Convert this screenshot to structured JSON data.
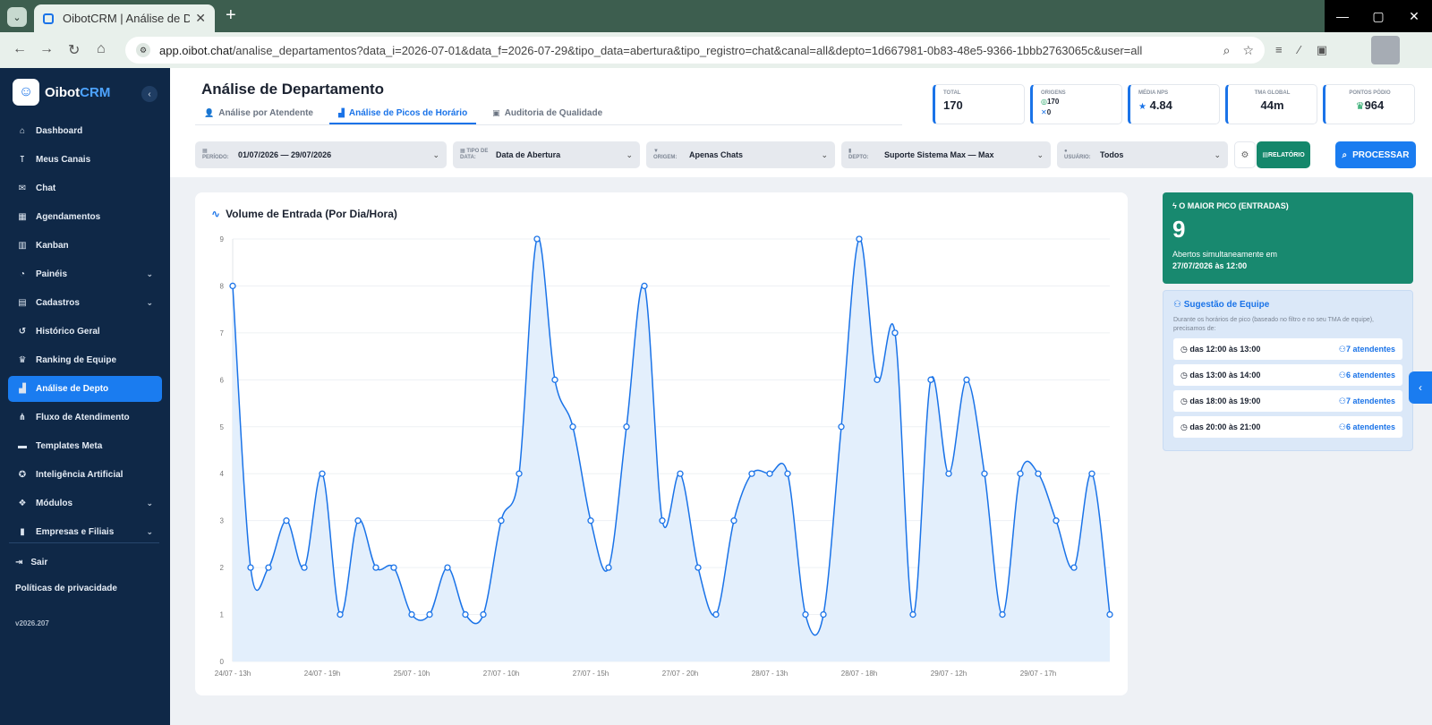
{
  "browser": {
    "tab_title": "OibotCRM | Análise de Departa",
    "url_host": "app.oibot.chat",
    "url_path": "/analise_departamentos?data_i=2026-07-01&data_f=2026-07-29&tipo_data=abertura&tipo_registro=chat&canal=all&depto=1d667981-0b83-48e5-9366-1bbb2763065c&user=all"
  },
  "sidebar": {
    "logo_a": "Oibot",
    "logo_b": "CRM",
    "items": [
      {
        "label": "Dashboard",
        "icon": "home-icon",
        "glyph": "⌂"
      },
      {
        "label": "Meus Canais",
        "icon": "antenna-icon",
        "glyph": "⊺"
      },
      {
        "label": "Chat",
        "icon": "chat-icon",
        "glyph": "✉"
      },
      {
        "label": "Agendamentos",
        "icon": "calendar-icon",
        "glyph": "▦"
      },
      {
        "label": "Kanban",
        "icon": "kanban-icon",
        "glyph": "▥"
      },
      {
        "label": "Painéis",
        "icon": "pie-chart-icon",
        "glyph": "◔",
        "expandable": true
      },
      {
        "label": "Cadastros",
        "icon": "id-card-icon",
        "glyph": "▤",
        "expandable": true
      },
      {
        "label": "Histórico Geral",
        "icon": "history-icon",
        "glyph": "↺"
      },
      {
        "label": "Ranking de Equipe",
        "icon": "trophy-icon",
        "glyph": "♛"
      },
      {
        "label": "Análise de Depto",
        "icon": "bar-chart-icon",
        "glyph": "▟",
        "active": true
      },
      {
        "label": "Fluxo de Atendimento",
        "icon": "flow-icon",
        "glyph": "⋔"
      },
      {
        "label": "Templates Meta",
        "icon": "template-icon",
        "glyph": "▬"
      },
      {
        "label": "Inteligência Artificial",
        "icon": "brain-icon",
        "glyph": "✪"
      },
      {
        "label": "Módulos",
        "icon": "cubes-icon",
        "glyph": "❖",
        "expandable": true
      },
      {
        "label": "Empresas e Filiais",
        "icon": "building-icon",
        "glyph": "▮",
        "expandable": true
      }
    ],
    "logout": "Sair",
    "privacy": "Políticas de privacidade",
    "version": "v2026.207"
  },
  "page": {
    "title": "Análise de Departamento",
    "tabs": [
      {
        "label": "Análise por Atendente",
        "icon": "user-icon",
        "glyph": "👤"
      },
      {
        "label": "Análise de Picos de Horário",
        "icon": "area-chart-icon",
        "glyph": "▟",
        "active": true
      },
      {
        "label": "Auditoria de Qualidade",
        "icon": "clipboard-icon",
        "glyph": "▣"
      }
    ]
  },
  "kpis": {
    "total_label": "TOTAL",
    "total_value": "170",
    "origins_label": "ORIGENS",
    "origins_whatsapp": "170",
    "origins_other": "0",
    "nps_label": "MÉDIA NPS",
    "nps_value": "4.84",
    "tma_label": "TMA GLOBAL",
    "tma_value": "44m",
    "points_label": "PONTOS PÓDIO",
    "points_value": "964"
  },
  "filters": {
    "period_label": "PERÍODO:",
    "period_value": "01/07/2026 — 29/07/2026",
    "datatype_label": "TIPO DE DATA:",
    "datatype_value": "Data de Abertura",
    "origin_label": "ORIGEM:",
    "origin_value": "Apenas Chats",
    "dept_label": "DEPTO:",
    "dept_value": "Suporte Sistema Max — Max",
    "user_label": "USUÁRIO:",
    "user_value": "Todos",
    "report_label": "RELATÓRIO",
    "process_label": "PROCESSAR"
  },
  "chart_title": "Volume de Entrada (Por Dia/Hora)",
  "chart_data": {
    "type": "line",
    "title": "Volume de Entrada (Por Dia/Hora)",
    "ylim": [
      0,
      9
    ],
    "yticks": [
      0,
      1,
      2,
      3,
      4,
      5,
      6,
      7,
      8,
      9
    ],
    "x_tick_labels": [
      "24/07 - 13h",
      "24/07 - 19h",
      "25/07 - 10h",
      "27/07 - 10h",
      "27/07 - 15h",
      "27/07 - 20h",
      "28/07 - 13h",
      "28/07 - 18h",
      "29/07 - 12h",
      "29/07 - 17h"
    ],
    "x_tick_every": 5,
    "values": [
      8,
      2,
      2,
      3,
      2,
      4,
      1,
      3,
      2,
      2,
      1,
      1,
      2,
      1,
      1,
      3,
      4,
      9,
      6,
      5,
      3,
      2,
      5,
      8,
      3,
      4,
      2,
      1,
      3,
      4,
      4,
      4,
      1,
      1,
      5,
      9,
      6,
      7,
      1,
      6,
      4,
      6,
      4,
      1,
      4,
      4,
      3,
      2,
      4,
      1
    ],
    "grid": true,
    "legend": "none",
    "color": "#1a73e8",
    "fill": "#e3effc"
  },
  "peak": {
    "title": "O MAIOR PICO (ENTRADAS)",
    "value": "9",
    "desc": "Abertos simultaneamente em",
    "when": "27/07/2026 às 12:00"
  },
  "team": {
    "title": "Sugestão de Equipe",
    "desc": "Durante os horários de pico (baseado no filtro e no seu TMA de equipe), precisamos de:",
    "slots": [
      {
        "time": "das 12:00 às 13:00",
        "count": "7 atendentes"
      },
      {
        "time": "das 13:00 às 14:00",
        "count": "6 atendentes"
      },
      {
        "time": "das 18:00 às 19:00",
        "count": "7 atendentes"
      },
      {
        "time": "das 20:00 às 21:00",
        "count": "6 atendentes"
      }
    ]
  }
}
